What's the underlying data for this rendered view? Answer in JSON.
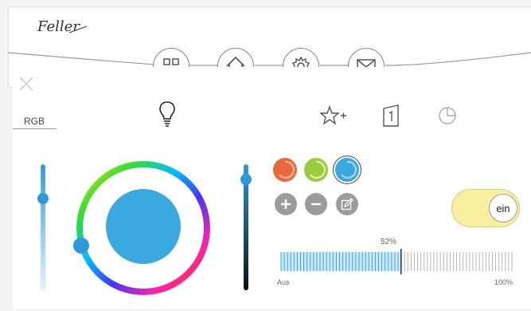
{
  "header": {
    "brand": "Feller"
  },
  "nav": [
    {
      "name": "nav-grid-button",
      "icon": "grid-icon"
    },
    {
      "name": "nav-home-button",
      "icon": "home-icon"
    },
    {
      "name": "nav-settings-button",
      "icon": "gear-icon"
    },
    {
      "name": "nav-mail-button",
      "icon": "mail-icon"
    }
  ],
  "panel": {
    "tab_label": "RGB",
    "close_icon": "close-icon",
    "bulb_icon": "lightbulb-icon",
    "favorite_icon": "star-plus-icon",
    "channel_icon": "door-1-icon",
    "timer_icon": "clock-pie-icon"
  },
  "colors": {
    "accent": "#3aa9df",
    "selected": "#3aa9df",
    "preset_orange": "#e86a3a",
    "preset_green": "#9ccc3d",
    "preset_blue": "#3aa9df",
    "toggle_bg": "#f8efa0"
  },
  "toggle": {
    "label": "ein",
    "state": "on"
  },
  "dimmer": {
    "value_label": "52%",
    "min_label": "Aus",
    "max_label": "100%",
    "value": 0.52
  },
  "sliders": {
    "left_level": 0.74,
    "right_level": 0.9
  }
}
